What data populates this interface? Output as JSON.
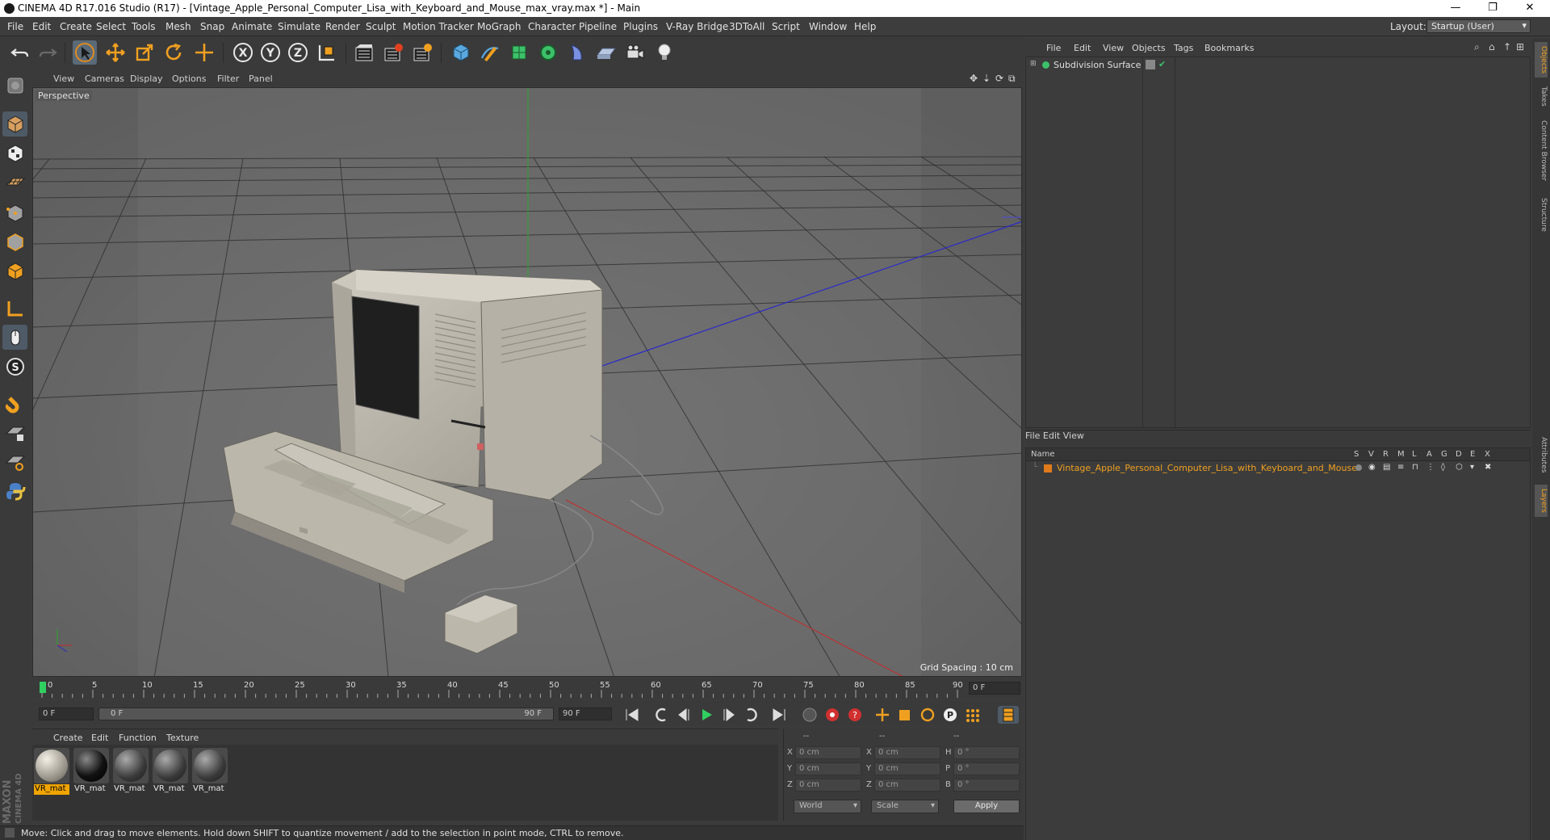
{
  "window": {
    "title": "CINEMA 4D R17.016 Studio (R17) - [Vintage_Apple_Personal_Computer_Lisa_with_Keyboard_and_Mouse_max_vray.max *] - Main",
    "minimize": "—",
    "restore": "❐",
    "close": "✕"
  },
  "menubar": {
    "items": [
      "File",
      "Edit",
      "Create",
      "Select",
      "Tools",
      "Mesh",
      "Snap",
      "Animate",
      "Simulate",
      "Render",
      "Sculpt",
      "Motion Tracker",
      "MoGraph",
      "Character",
      "Pipeline",
      "Plugins",
      "V-Ray Bridge",
      "3DToAll",
      "Script",
      "Window",
      "Help"
    ],
    "layout_label": "Layout:",
    "layout_value": "Startup (User)"
  },
  "toolbar": {
    "icons": [
      "undo-icon",
      "redo-icon",
      "select-arrow-icon",
      "move-icon",
      "scale-icon",
      "rotate-icon",
      "live-move-icon",
      "x-axis-icon",
      "y-axis-icon",
      "z-axis-icon",
      "coordinate-system-icon",
      "render-view-icon",
      "render-picture-viewer-icon",
      "edit-render-settings-icon",
      "cube-icon",
      "pen-icon",
      "subdivision-icon",
      "mograph-cloner-icon",
      "deformer-icon",
      "floor-icon",
      "camera-icon",
      "light-icon"
    ],
    "axis_labels": [
      "X",
      "Y",
      "Z"
    ]
  },
  "viewport": {
    "menu": [
      "View",
      "Cameras",
      "Display",
      "Options",
      "Filter",
      "Panel"
    ],
    "label": "Perspective",
    "grid_spacing": "Grid Spacing : 10 cm"
  },
  "timeline": {
    "ticks": [
      "0",
      "5",
      "10",
      "15",
      "20",
      "25",
      "30",
      "35",
      "40",
      "45",
      "50",
      "55",
      "60",
      "65",
      "70",
      "75",
      "80",
      "85",
      "90"
    ],
    "current_frame": "0 F",
    "start_field": "0 F",
    "range_start": "0 F",
    "range_end": "90 F",
    "end_field": "90 F"
  },
  "materials": {
    "menu": [
      "Create",
      "Edit",
      "Function",
      "Texture"
    ],
    "items": [
      {
        "label": "VR_mat",
        "selected": true,
        "color": "light"
      },
      {
        "label": "VR_mat",
        "selected": false,
        "color": "black"
      },
      {
        "label": "VR_mat",
        "selected": false,
        "color": "grey"
      },
      {
        "label": "VR_mat",
        "selected": false,
        "color": "grey"
      },
      {
        "label": "VR_mat",
        "selected": false,
        "color": "grey"
      }
    ]
  },
  "coordinates": {
    "headers": [
      "--",
      "--",
      "--"
    ],
    "rows": [
      {
        "a": "X",
        "av": "0 cm",
        "b": "X",
        "bv": "0 cm",
        "c": "H",
        "cv": "0 °"
      },
      {
        "a": "Y",
        "av": "0 cm",
        "b": "Y",
        "bv": "0 cm",
        "c": "P",
        "cv": "0 °"
      },
      {
        "a": "Z",
        "av": "0 cm",
        "b": "Z",
        "bv": "0 cm",
        "c": "B",
        "cv": "0 °"
      }
    ],
    "space": "World",
    "mode": "Scale",
    "apply": "Apply"
  },
  "objects": {
    "menu": [
      "File",
      "Edit",
      "View",
      "Objects",
      "Tags",
      "Bookmarks"
    ],
    "tree": [
      {
        "name": "Subdivision Surface"
      }
    ]
  },
  "layers": {
    "menu": [
      "File",
      "Edit",
      "View"
    ],
    "header": "Name",
    "columns": [
      "S",
      "V",
      "R",
      "M",
      "L",
      "A",
      "G",
      "D",
      "E",
      "X"
    ],
    "rows": [
      {
        "name": "Vintage_Apple_Personal_Computer_Lisa_with_Keyboard_and_Mouse",
        "color": "#e07a1a"
      }
    ]
  },
  "side_tabs": [
    "Objects",
    "Takes",
    "Content Browser",
    "Structure",
    "Attributes",
    "Layers"
  ],
  "status": "Move: Click and drag to move elements. Hold down SHIFT to quantize movement / add to the selection in point mode, CTRL to remove.",
  "brand": {
    "line1": "MAXON",
    "line2": "CINEMA 4D"
  }
}
